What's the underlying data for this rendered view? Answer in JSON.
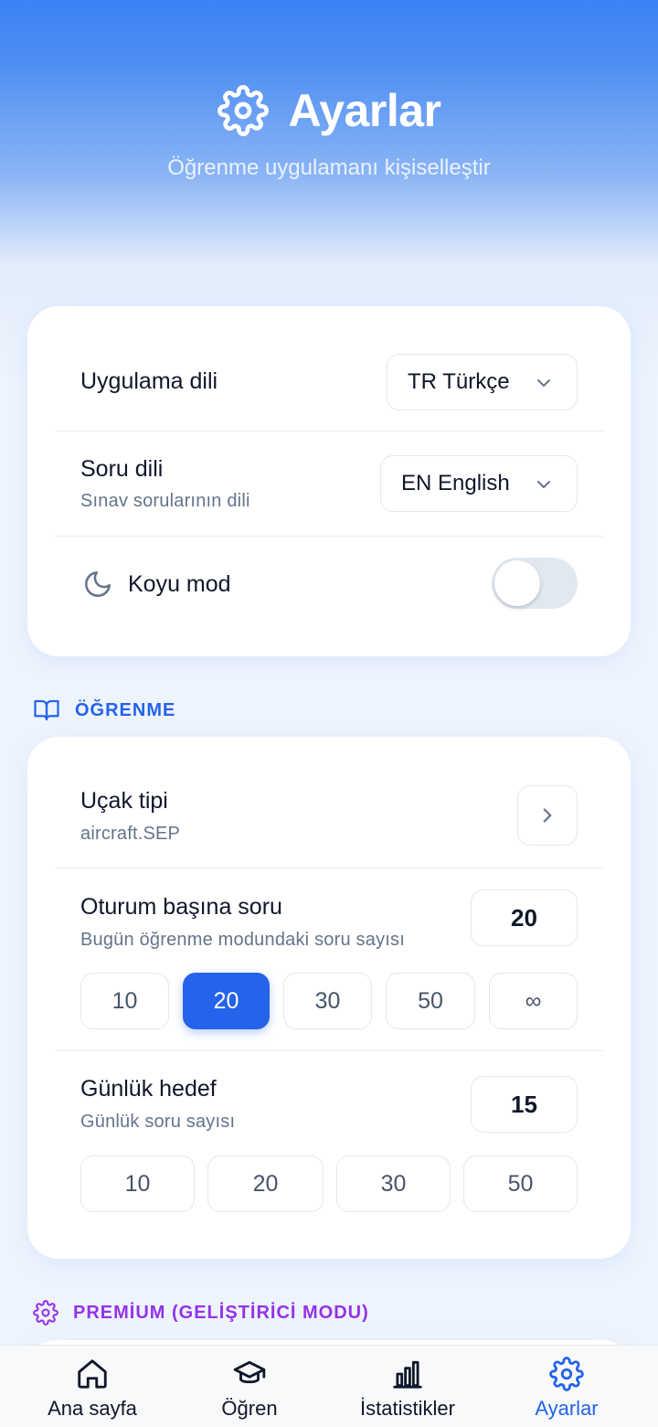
{
  "header": {
    "title": "Ayarlar",
    "subtitle": "Öğrenme uygulamanı kişiselleştir"
  },
  "general": {
    "app_language": {
      "label": "Uygulama dili",
      "value": "TR Türkçe"
    },
    "question_language": {
      "label": "Soru dili",
      "sublabel": "Sınav sorularının dili",
      "value": "EN English"
    },
    "dark_mode": {
      "label": "Koyu mod",
      "enabled": false
    }
  },
  "learning": {
    "section_title": "ÖĞRENME",
    "aircraft": {
      "label": "Uçak tipi",
      "value": "aircraft.SEP"
    },
    "per_session": {
      "label": "Oturum başına soru",
      "sublabel": "Bugün öğrenme modundaki soru sayısı",
      "value": "20",
      "options": [
        "10",
        "20",
        "30",
        "50",
        "∞"
      ],
      "selected": "20"
    },
    "daily_goal": {
      "label": "Günlük hedef",
      "sublabel": "Günlük soru sayısı",
      "value": "15",
      "options": [
        "10",
        "20",
        "30",
        "50"
      ]
    }
  },
  "premium": {
    "section_title": "PREMİUM (GELİŞTİRİCİ MODU)"
  },
  "tabbar": {
    "items": [
      {
        "label": "Ana sayfa",
        "icon": "home-icon"
      },
      {
        "label": "Öğren",
        "icon": "graduation-cap-icon"
      },
      {
        "label": "İstatistikler",
        "icon": "bar-chart-icon"
      },
      {
        "label": "Ayarlar",
        "icon": "gear-icon"
      }
    ],
    "active": "Ayarlar"
  },
  "colors": {
    "accent": "#2563eb",
    "section_learning": "#2563eb",
    "section_premium": "#9333ea"
  }
}
